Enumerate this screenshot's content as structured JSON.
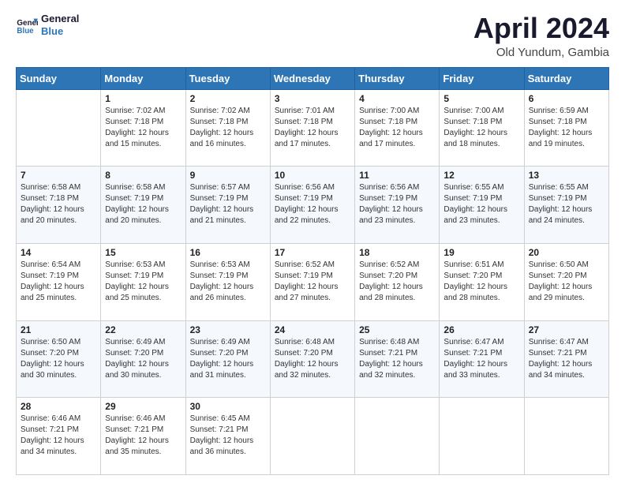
{
  "logo": {
    "line1": "General",
    "line2": "Blue"
  },
  "title": "April 2024",
  "subtitle": "Old Yundum, Gambia",
  "header_days": [
    "Sunday",
    "Monday",
    "Tuesday",
    "Wednesday",
    "Thursday",
    "Friday",
    "Saturday"
  ],
  "weeks": [
    [
      {
        "num": "",
        "info": ""
      },
      {
        "num": "1",
        "info": "Sunrise: 7:02 AM\nSunset: 7:18 PM\nDaylight: 12 hours\nand 15 minutes."
      },
      {
        "num": "2",
        "info": "Sunrise: 7:02 AM\nSunset: 7:18 PM\nDaylight: 12 hours\nand 16 minutes."
      },
      {
        "num": "3",
        "info": "Sunrise: 7:01 AM\nSunset: 7:18 PM\nDaylight: 12 hours\nand 17 minutes."
      },
      {
        "num": "4",
        "info": "Sunrise: 7:00 AM\nSunset: 7:18 PM\nDaylight: 12 hours\nand 17 minutes."
      },
      {
        "num": "5",
        "info": "Sunrise: 7:00 AM\nSunset: 7:18 PM\nDaylight: 12 hours\nand 18 minutes."
      },
      {
        "num": "6",
        "info": "Sunrise: 6:59 AM\nSunset: 7:18 PM\nDaylight: 12 hours\nand 19 minutes."
      }
    ],
    [
      {
        "num": "7",
        "info": "Sunrise: 6:58 AM\nSunset: 7:18 PM\nDaylight: 12 hours\nand 20 minutes."
      },
      {
        "num": "8",
        "info": "Sunrise: 6:58 AM\nSunset: 7:19 PM\nDaylight: 12 hours\nand 20 minutes."
      },
      {
        "num": "9",
        "info": "Sunrise: 6:57 AM\nSunset: 7:19 PM\nDaylight: 12 hours\nand 21 minutes."
      },
      {
        "num": "10",
        "info": "Sunrise: 6:56 AM\nSunset: 7:19 PM\nDaylight: 12 hours\nand 22 minutes."
      },
      {
        "num": "11",
        "info": "Sunrise: 6:56 AM\nSunset: 7:19 PM\nDaylight: 12 hours\nand 23 minutes."
      },
      {
        "num": "12",
        "info": "Sunrise: 6:55 AM\nSunset: 7:19 PM\nDaylight: 12 hours\nand 23 minutes."
      },
      {
        "num": "13",
        "info": "Sunrise: 6:55 AM\nSunset: 7:19 PM\nDaylight: 12 hours\nand 24 minutes."
      }
    ],
    [
      {
        "num": "14",
        "info": "Sunrise: 6:54 AM\nSunset: 7:19 PM\nDaylight: 12 hours\nand 25 minutes."
      },
      {
        "num": "15",
        "info": "Sunrise: 6:53 AM\nSunset: 7:19 PM\nDaylight: 12 hours\nand 25 minutes."
      },
      {
        "num": "16",
        "info": "Sunrise: 6:53 AM\nSunset: 7:19 PM\nDaylight: 12 hours\nand 26 minutes."
      },
      {
        "num": "17",
        "info": "Sunrise: 6:52 AM\nSunset: 7:19 PM\nDaylight: 12 hours\nand 27 minutes."
      },
      {
        "num": "18",
        "info": "Sunrise: 6:52 AM\nSunset: 7:20 PM\nDaylight: 12 hours\nand 28 minutes."
      },
      {
        "num": "19",
        "info": "Sunrise: 6:51 AM\nSunset: 7:20 PM\nDaylight: 12 hours\nand 28 minutes."
      },
      {
        "num": "20",
        "info": "Sunrise: 6:50 AM\nSunset: 7:20 PM\nDaylight: 12 hours\nand 29 minutes."
      }
    ],
    [
      {
        "num": "21",
        "info": "Sunrise: 6:50 AM\nSunset: 7:20 PM\nDaylight: 12 hours\nand 30 minutes."
      },
      {
        "num": "22",
        "info": "Sunrise: 6:49 AM\nSunset: 7:20 PM\nDaylight: 12 hours\nand 30 minutes."
      },
      {
        "num": "23",
        "info": "Sunrise: 6:49 AM\nSunset: 7:20 PM\nDaylight: 12 hours\nand 31 minutes."
      },
      {
        "num": "24",
        "info": "Sunrise: 6:48 AM\nSunset: 7:20 PM\nDaylight: 12 hours\nand 32 minutes."
      },
      {
        "num": "25",
        "info": "Sunrise: 6:48 AM\nSunset: 7:21 PM\nDaylight: 12 hours\nand 32 minutes."
      },
      {
        "num": "26",
        "info": "Sunrise: 6:47 AM\nSunset: 7:21 PM\nDaylight: 12 hours\nand 33 minutes."
      },
      {
        "num": "27",
        "info": "Sunrise: 6:47 AM\nSunset: 7:21 PM\nDaylight: 12 hours\nand 34 minutes."
      }
    ],
    [
      {
        "num": "28",
        "info": "Sunrise: 6:46 AM\nSunset: 7:21 PM\nDaylight: 12 hours\nand 34 minutes."
      },
      {
        "num": "29",
        "info": "Sunrise: 6:46 AM\nSunset: 7:21 PM\nDaylight: 12 hours\nand 35 minutes."
      },
      {
        "num": "30",
        "info": "Sunrise: 6:45 AM\nSunset: 7:21 PM\nDaylight: 12 hours\nand 36 minutes."
      },
      {
        "num": "",
        "info": ""
      },
      {
        "num": "",
        "info": ""
      },
      {
        "num": "",
        "info": ""
      },
      {
        "num": "",
        "info": ""
      }
    ]
  ]
}
